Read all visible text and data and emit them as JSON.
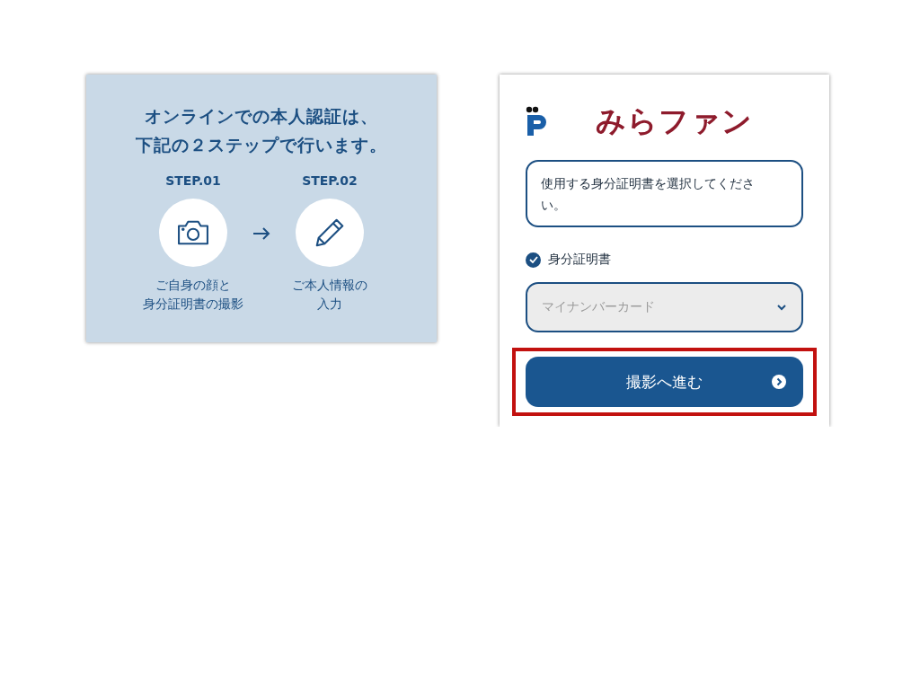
{
  "intro_panel": {
    "heading_lines": [
      "オンラインでの本人認証は、",
      "下記の２ステップで行います。"
    ],
    "steps": [
      {
        "label": "STEP.01",
        "kind": "camera",
        "caption_lines": [
          "ご自身の顔と",
          "身分証明書の撮影"
        ]
      },
      {
        "label": "STEP.02",
        "kind": "pencil",
        "caption_lines": [
          "ご本人情報の",
          "入力"
        ]
      }
    ]
  },
  "form_panel": {
    "brand": "みらファン",
    "instruction": "使用する身分証明書を選択してください。",
    "checkbox": {
      "label": "身分証明書",
      "checked": true
    },
    "select": {
      "placeholder": "マイナンバーカード"
    },
    "button": {
      "label": "撮影へ進む",
      "highlighted": true
    }
  }
}
